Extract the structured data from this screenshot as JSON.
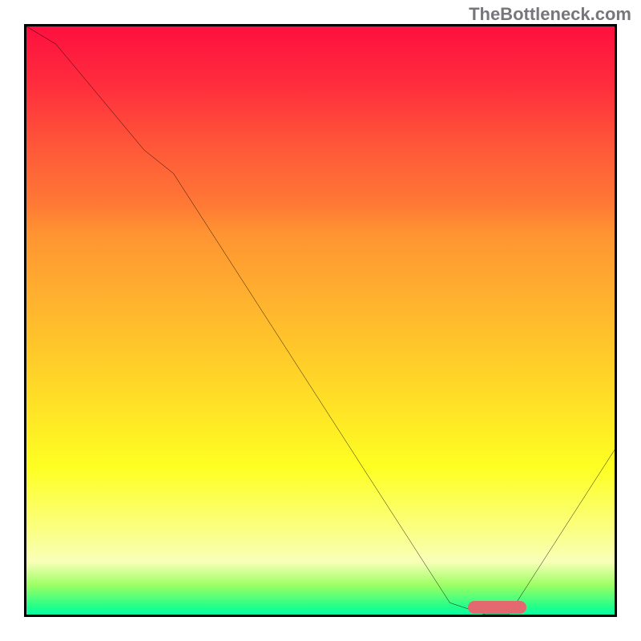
{
  "watermark": "TheBottleneck.com",
  "chart_data": {
    "type": "line",
    "title": "",
    "xlabel": "",
    "ylabel": "",
    "xlim": [
      0,
      100
    ],
    "ylim": [
      0,
      100
    ],
    "series": [
      {
        "name": "curve",
        "x": [
          0,
          5,
          20,
          25,
          72,
          78,
          82,
          100
        ],
        "y": [
          100,
          97,
          79,
          75,
          2,
          0,
          0,
          28
        ]
      }
    ],
    "marker": {
      "x_range": [
        75,
        85
      ],
      "y": 1
    },
    "background_gradient": {
      "direction": "top-to-bottom",
      "stops": [
        {
          "pos": 0,
          "color": "#fe103f"
        },
        {
          "pos": 10,
          "color": "#ff2d3d"
        },
        {
          "pos": 20,
          "color": "#ff5639"
        },
        {
          "pos": 30,
          "color": "#ff7835"
        },
        {
          "pos": 35,
          "color": "#ff9332"
        },
        {
          "pos": 45,
          "color": "#ffae2f"
        },
        {
          "pos": 55,
          "color": "#ffc82a"
        },
        {
          "pos": 65,
          "color": "#ffe326"
        },
        {
          "pos": 75,
          "color": "#feff22"
        },
        {
          "pos": 85,
          "color": "#fbff7d"
        },
        {
          "pos": 91,
          "color": "#f9ffb8"
        },
        {
          "pos": 95,
          "color": "#9cff64"
        },
        {
          "pos": 99,
          "color": "#18ff8e"
        },
        {
          "pos": 100,
          "color": "#0dffa5"
        }
      ]
    }
  }
}
